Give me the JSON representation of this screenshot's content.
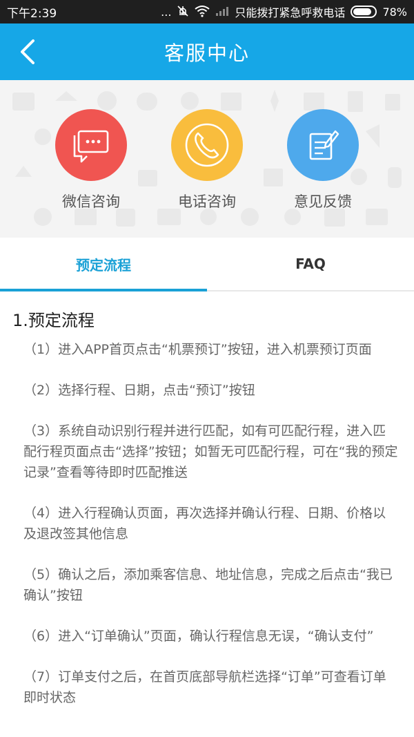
{
  "status_bar": {
    "time": "下午2:39",
    "dots": "...",
    "carrier": "只能拨打紧急呼救电话",
    "battery": "78%",
    "battery_level": 0.78
  },
  "header": {
    "title": "客服中心",
    "back_icon": "chevron-left-icon"
  },
  "hero": {
    "items": [
      {
        "label": "微信咨询",
        "icon": "chat-bubble-icon",
        "color": "#f05551"
      },
      {
        "label": "电话咨询",
        "icon": "phone-icon",
        "color": "#f9bd3d"
      },
      {
        "label": "意见反馈",
        "icon": "edit-note-icon",
        "color": "#4ea9ec"
      }
    ]
  },
  "tabs": [
    {
      "label": "预定流程",
      "active": true
    },
    {
      "label": "FAQ",
      "active": false
    }
  ],
  "content": {
    "section_title": "1.预定流程",
    "steps": [
      "（1）进入APP首页点击“机票预订”按钮，进入机票预订页面",
      "（2）选择行程、日期，点击“预订”按钮",
      "（3）系统自动识别行程并进行匹配，如有可匹配行程，进入匹配行程页面点击“选择”按钮；如暂无可匹配行程，可在“我的预定记录”查看等待即时匹配推送",
      "（4）进入行程确认页面，再次选择并确认行程、日期、价格以及退改签其他信息",
      "（5）确认之后，添加乘客信息、地址信息，完成之后点击“我已确认”按钮",
      "（6）进入“订单确认”页面，确认行程信息无误，“确认支付”",
      "（7）订单支付之后，在首页底部导航栏选择“订单”可查看订单即时状态"
    ]
  },
  "colors": {
    "header_blue": "#16a7e7",
    "tab_active": "#1aa1d6"
  }
}
